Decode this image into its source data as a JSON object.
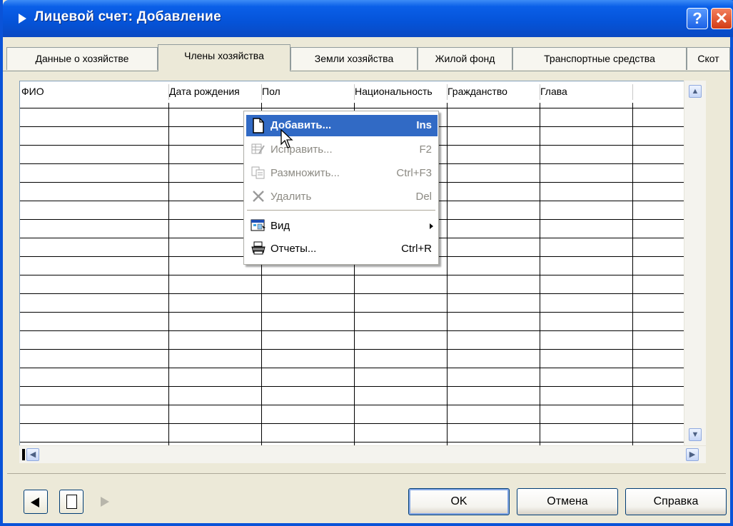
{
  "window": {
    "title": "Лицевой счет: Добавление",
    "help_label": "?",
    "close_label": "✕"
  },
  "tabs": [
    {
      "label": "Данные о хозяйстве",
      "active": false
    },
    {
      "label": "Члены хозяйства",
      "active": true
    },
    {
      "label": "Земли хозяйства",
      "active": false
    },
    {
      "label": "Жилой фонд",
      "active": false
    },
    {
      "label": "Транспортные средства",
      "active": false
    },
    {
      "label": "Скот",
      "active": false
    }
  ],
  "grid": {
    "columns": [
      "ФИО",
      "Дата рождения",
      "Пол",
      "Национальность",
      "Гражданство",
      "Глава"
    ],
    "rows": []
  },
  "context_menu": {
    "items": [
      {
        "icon": "new-document-icon",
        "label": "Добавить...",
        "shortcut": "Ins",
        "state": "highlighted"
      },
      {
        "icon": "edit-table-icon",
        "label": "Исправить...",
        "shortcut": "F2",
        "state": "disabled"
      },
      {
        "icon": "duplicate-icon",
        "label": "Размножить...",
        "shortcut": "Ctrl+F3",
        "state": "disabled"
      },
      {
        "icon": "delete-icon",
        "label": "Удалить",
        "shortcut": "Del",
        "state": "disabled"
      },
      {
        "icon": "view-icon",
        "label": "Вид",
        "shortcut": "",
        "state": "submenu"
      },
      {
        "icon": "printer-icon",
        "label": "Отчеты...",
        "shortcut": "Ctrl+R",
        "state": "normal"
      }
    ]
  },
  "footer": {
    "ok_label": "OK",
    "cancel_label": "Отмена",
    "help_label": "Справка"
  },
  "colors": {
    "titlebar": "#0553d8",
    "menu_highlight": "#316ac5",
    "dialog_bg": "#ece9d8"
  }
}
